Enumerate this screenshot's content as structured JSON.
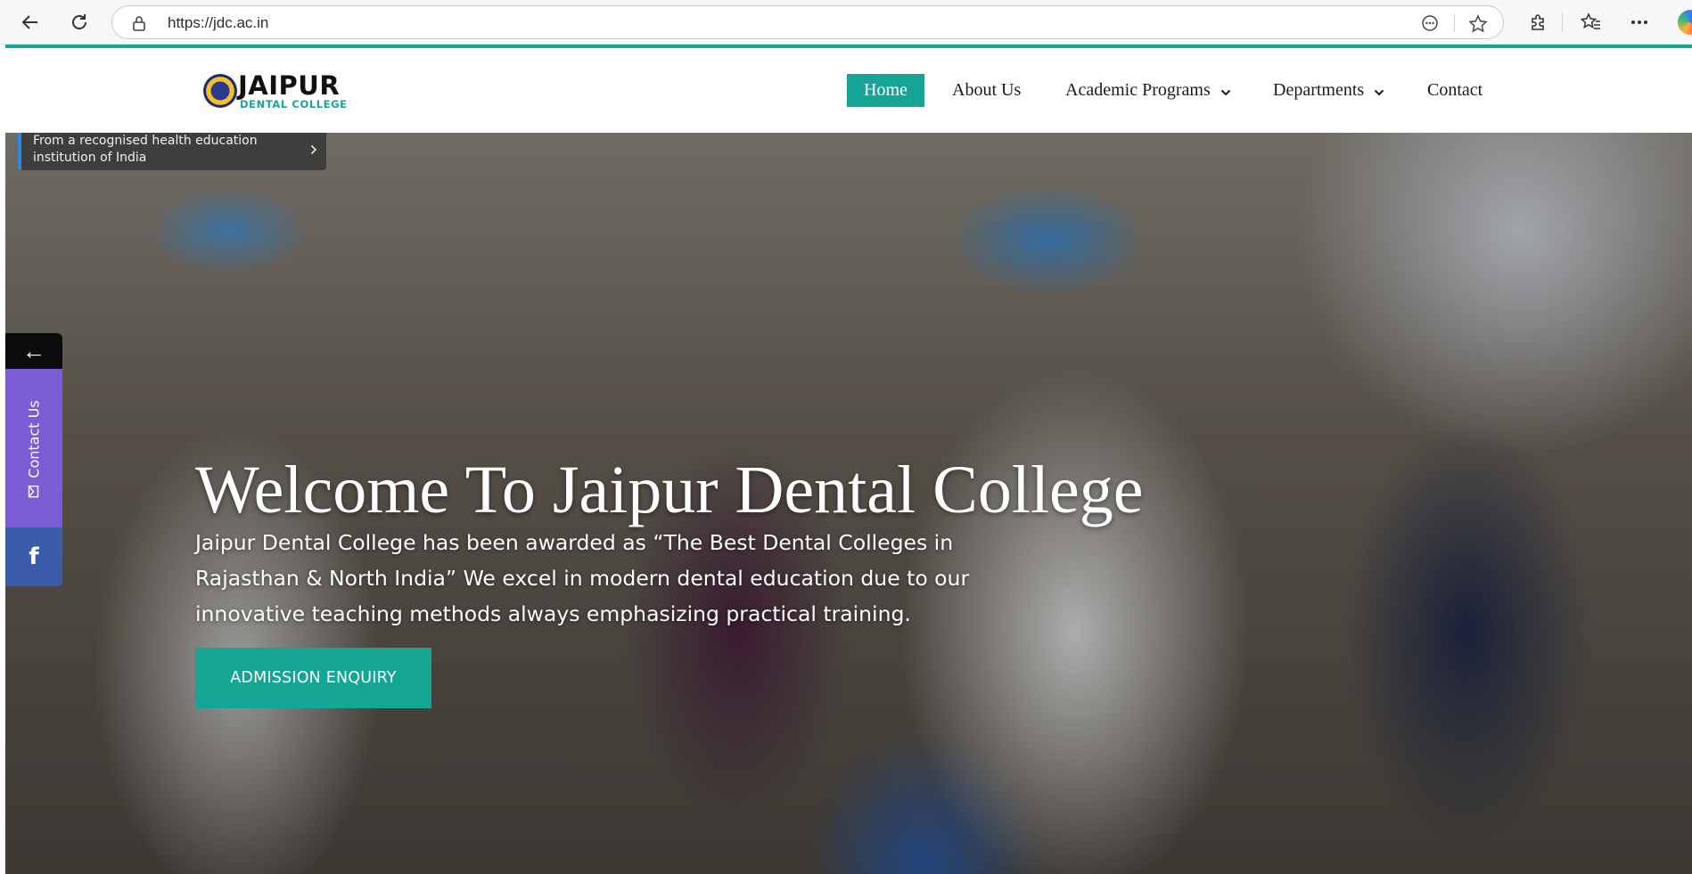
{
  "browser": {
    "url": "https://jdc.ac.in",
    "icons": [
      "back-icon",
      "refresh-icon",
      "lock-icon",
      "reader-icon",
      "star-icon",
      "extensions-icon",
      "favorites-icon",
      "more-icon",
      "copilot-icon"
    ]
  },
  "logo": {
    "name": "JAIPUR",
    "sub": "DENTAL COLLEGE"
  },
  "nav": {
    "items": [
      {
        "label": "Home",
        "active": true
      },
      {
        "label": "About Us",
        "dropdown": false
      },
      {
        "label": "Academic Programs",
        "dropdown": true
      },
      {
        "label": "Departments",
        "dropdown": true
      },
      {
        "label": "Contact",
        "dropdown": false
      }
    ]
  },
  "notice": {
    "text": "From a recognised health education institution of India"
  },
  "hero": {
    "title": "Welcome To Jaipur Dental College",
    "description": "Jaipur Dental College has been awarded as “The Best Dental Colleges in Rajasthan & North India” We excel in modern dental education due to our innovative teaching methods always emphasizing practical training.",
    "cta": "ADMISSION ENQUIRY"
  },
  "side": {
    "back": "←",
    "contact": "Contact Us",
    "facebook": "f"
  },
  "colors": {
    "teal": "#16a594",
    "purple": "#7b5bd6",
    "facebook": "#3b5ca8"
  }
}
